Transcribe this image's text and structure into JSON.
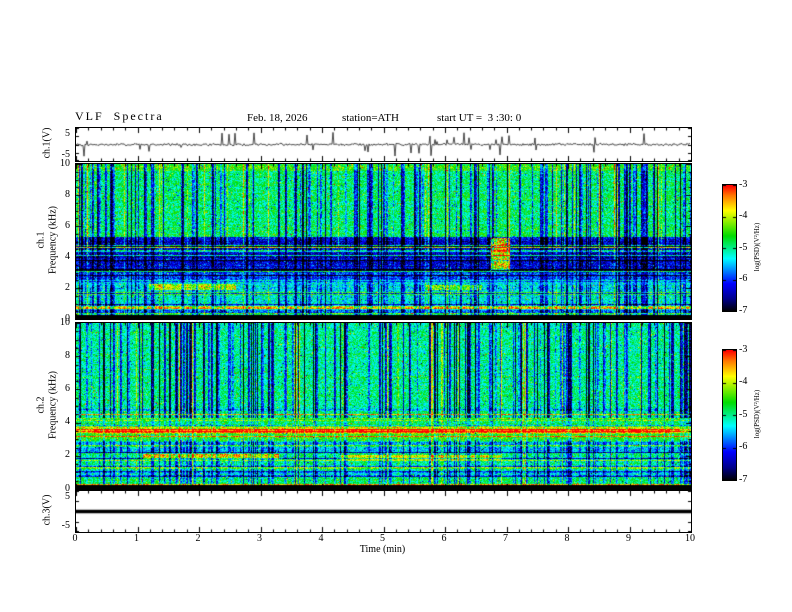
{
  "header": {
    "title": "VLF  Spectra",
    "date": "Feb. 18, 2026",
    "station": "station=ATH",
    "start_ut": "start UT =  3 :30: 0"
  },
  "x_axis": {
    "label": "Time  (min)",
    "min": 0,
    "max": 10,
    "major_ticks": [
      "0",
      "1",
      "2",
      "3",
      "4",
      "5",
      "6",
      "7",
      "8",
      "9",
      "10"
    ],
    "minor_step": 0.2
  },
  "panels": {
    "ch1_wave": {
      "ylabel": "ch.1(V)",
      "ymin": -5,
      "ymax": 5,
      "ytick_labels": [
        "5",
        "-5"
      ]
    },
    "ch1_spec": {
      "ylabel_channel": "ch.1",
      "ylabel_axis": "Frequency (kHz)",
      "ymin": 0,
      "ymax": 10,
      "ytick_labels": [
        "10",
        "8",
        "6",
        "4",
        "2",
        "0"
      ]
    },
    "ch2_spec": {
      "ylabel_channel": "ch.2",
      "ylabel_axis": "Frequency (kHz)",
      "ymin": 0,
      "ymax": 10,
      "ytick_labels": [
        "10",
        "8",
        "6",
        "4",
        "2",
        "0"
      ]
    },
    "ch3_wave": {
      "ylabel": "ch.3(V)",
      "ymin": -5,
      "ymax": 5,
      "ytick_labels": [
        "5",
        "-5"
      ]
    }
  },
  "colorbars": [
    {
      "label": "log(PSD)(V²/Hz)",
      "min": -7,
      "max": -3,
      "tick_labels": [
        "-3",
        "-4",
        "-5",
        "-6",
        "-7"
      ]
    },
    {
      "label": "log(PSD)(V²/Hz)",
      "min": -7,
      "max": -3,
      "tick_labels": [
        "-3",
        "-4",
        "-5",
        "-6",
        "-7"
      ]
    }
  ],
  "colormap": {
    "stops": [
      [
        0,
        "#000000"
      ],
      [
        0.1,
        "#00008b"
      ],
      [
        0.22,
        "#0000ff"
      ],
      [
        0.42,
        "#00ffff"
      ],
      [
        0.6,
        "#00dd00"
      ],
      [
        0.8,
        "#ffff00"
      ],
      [
        0.92,
        "#ff7700"
      ],
      [
        1,
        "#ff0000"
      ]
    ]
  },
  "chart_data": [
    {
      "type": "line",
      "panel": "ch1_wave",
      "xlim": [
        0,
        10
      ],
      "ylim": [
        -5,
        5
      ],
      "description": "Broadband noisy voltage trace centered on 0 V with frequent impulsive spikes up to about ±4 V across the whole 10-minute record",
      "noise_sigma": 0.22,
      "spike_rate": 0.07,
      "spike_max": 3.8
    },
    {
      "type": "heatmap",
      "panel": "ch1_spec",
      "xlim": [
        0,
        10
      ],
      "ylim": [
        0,
        10
      ],
      "zlim": [
        -7,
        -3
      ],
      "description": "ch.1 VLF spectrogram: green background above ~5 kHz with dark-blue vertical dropout stripes, deep-blue band between ~3-5 kHz crossed by cyan horizontal interference lines, mixed cyan/green/yellow lines below 2.5 kHz, solid black band below ~0.3 kHz, orange enhancement near t=6.9 min between 3-5 kHz",
      "bands": [
        {
          "f0": 0,
          "f1": 0.28,
          "level": -7.2
        },
        {
          "f0": 0.28,
          "f1": 0.7,
          "level": -5.8
        },
        {
          "f0": 0.7,
          "f1": 1.6,
          "level": -5.15
        },
        {
          "f0": 1.6,
          "f1": 2.4,
          "level": -5.4
        },
        {
          "f0": 2.4,
          "f1": 3.1,
          "level": -5.9
        },
        {
          "f0": 3.1,
          "f1": 5.3,
          "level": -6.3
        },
        {
          "f0": 5.3,
          "f1": 9.6,
          "level": -4.9
        },
        {
          "f0": 9.6,
          "f1": 10.01,
          "level": -4.5
        }
      ],
      "stripe_scales": [
        {
          "fmin": 4.4,
          "scale": 1
        },
        {
          "fmin": 2.2,
          "scale": 0.45
        },
        {
          "fmin": 0.3,
          "scale": 0.75
        },
        {
          "fmin": 0,
          "scale": 0
        }
      ],
      "noise": 0.9,
      "stripe_dark_rate": 0.26,
      "stripe_bright_rate": 0.05,
      "h_lines": 46,
      "h_line_fmax": 5.4,
      "hot_spots": [
        {
          "t0": 6.75,
          "t1": 7.05,
          "f0": 3.2,
          "f1": 5.2,
          "boost": 2.6
        },
        {
          "t0": 1.2,
          "t1": 2.6,
          "f0": 1.9,
          "f1": 2.2,
          "boost": 1.5
        },
        {
          "t0": 5.7,
          "t1": 6.6,
          "f0": 1.9,
          "f1": 2.15,
          "boost": 1.2
        }
      ]
    },
    {
      "type": "heatmap",
      "panel": "ch2_spec",
      "xlim": [
        0,
        10
      ],
      "ylim": [
        0,
        10
      ],
      "zlim": [
        -7,
        -3
      ],
      "description": "ch.2 VLF spectrogram: green/cyan background with dark-blue vertical dropout stripes above ~4.5 kHz, bright yellow horizontal band near 3.3-3.8 kHz, green region with yellow and dark-red horizontal interference lines below 2.5 kHz, solid black band below ~0.3 kHz",
      "bands": [
        {
          "f0": 0,
          "f1": 0.28,
          "level": -7.2
        },
        {
          "f0": 0.28,
          "f1": 0.75,
          "level": -4.9
        },
        {
          "f0": 0.75,
          "f1": 1.5,
          "level": -5.1
        },
        {
          "f0": 1.5,
          "f1": 2.2,
          "level": -5.0
        },
        {
          "f0": 2.2,
          "f1": 3.0,
          "level": -5.4
        },
        {
          "f0": 3.0,
          "f1": 3.4,
          "level": -4.6
        },
        {
          "f0": 3.4,
          "f1": 3.75,
          "level": -4.1
        },
        {
          "f0": 3.75,
          "f1": 4.3,
          "level": -4.8
        },
        {
          "f0": 4.3,
          "f1": 10.01,
          "level": -5.0
        }
      ],
      "stripe_scales": [
        {
          "fmin": 4.3,
          "scale": 1
        },
        {
          "fmin": 3.0,
          "scale": 0.35
        },
        {
          "fmin": 0.3,
          "scale": 0.65
        },
        {
          "fmin": 0,
          "scale": 0
        }
      ],
      "noise": 0.85,
      "stripe_dark_rate": 0.27,
      "stripe_bright_rate": 0.06,
      "h_lines": 50,
      "h_line_fmax": 5.0,
      "hot_spots": [
        {
          "t0": 1.1,
          "t1": 3.3,
          "f0": 1.85,
          "f1": 2.1,
          "boost": 1.6
        },
        {
          "t0": 4.3,
          "t1": 6.9,
          "f0": 1.8,
          "f1": 2.0,
          "boost": 1.3
        },
        {
          "t0": 0.3,
          "t1": 9.7,
          "f0": 3.35,
          "f1": 3.6,
          "boost": 0.5
        }
      ]
    },
    {
      "type": "line",
      "panel": "ch3_wave",
      "xlim": [
        0,
        10
      ],
      "ylim": [
        -5,
        5
      ],
      "constant": 0,
      "line_width": 3.5,
      "description": "Flat thick black trace at 0 V for the full 10 minutes (channel inactive)"
    }
  ]
}
